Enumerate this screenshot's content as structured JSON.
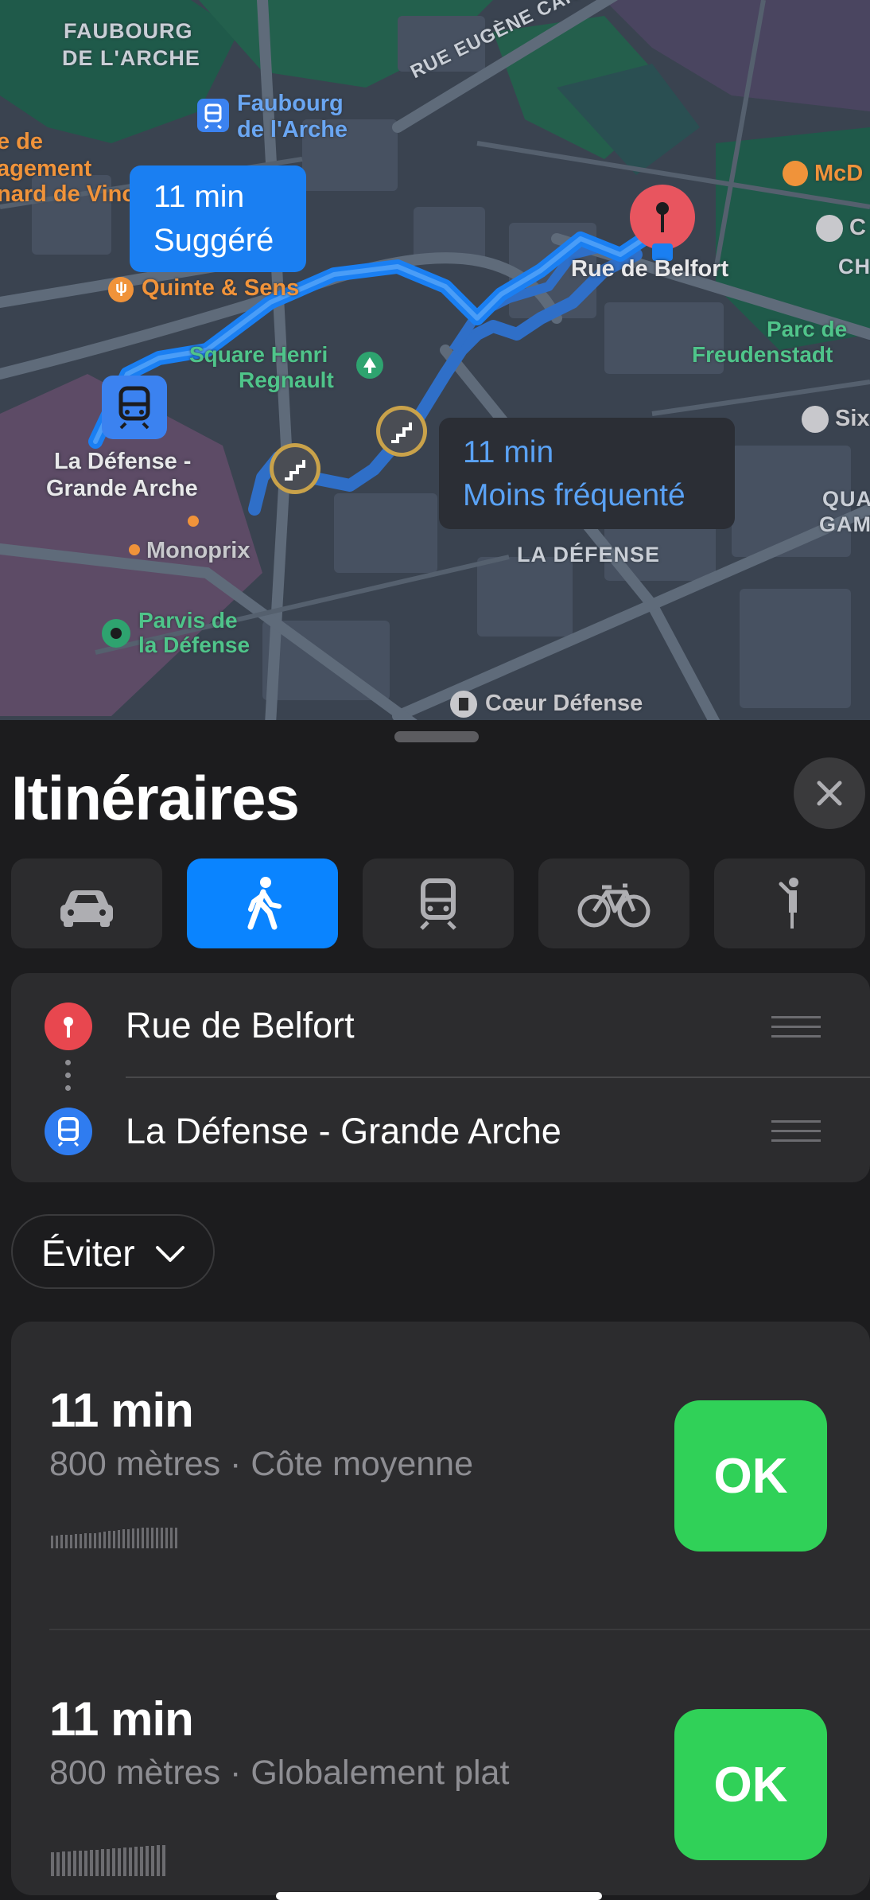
{
  "map": {
    "streets": [
      "FAUBOURG",
      "DE L'ARCHE",
      "RUE EUGÈNE CARON",
      "LA DÉFENSE"
    ],
    "edge_labels": [
      "e de",
      "agement",
      "nard de Vinci"
    ],
    "metro_station": [
      "Faubourg",
      "de l'Arche"
    ],
    "restaurant": "Quinte & Sens",
    "park_square": [
      "Square Henri",
      "Regnault"
    ],
    "destination_label": "Rue de Belfort",
    "start_station": [
      "La Défense -",
      "Grande Arche"
    ],
    "monoprix": "Monoprix",
    "parvis": [
      "Parvis de",
      "la Défense"
    ],
    "coeur": "Cœur Défense",
    "parc": [
      "Parc de",
      "Freudenstadt"
    ],
    "right_edge": {
      "mcd": "McD",
      "c": "C",
      "ch": "CH",
      "six": "Six",
      "quartier": [
        "QUA",
        "GAM"
      ]
    },
    "callout_suggested": {
      "time": "11 min",
      "label": "Suggéré"
    },
    "callout_alt": {
      "time": "11 min",
      "label": "Moins fréquenté"
    },
    "colors": {
      "route": "#1a7ff2",
      "alt_route": "#2f6fc8",
      "dest_pin": "#e8555f"
    }
  },
  "sheet": {
    "title": "Itinéraires",
    "modes": [
      {
        "icon": "car-icon",
        "active": false
      },
      {
        "icon": "walk-icon",
        "active": true
      },
      {
        "icon": "transit-icon",
        "active": false
      },
      {
        "icon": "bike-icon",
        "active": false
      },
      {
        "icon": "rideshare-icon",
        "active": false
      }
    ],
    "from": "Rue de Belfort",
    "to": "La Défense - Grande Arche",
    "avoid_label": "Éviter",
    "routes": [
      {
        "time": "11 min",
        "detail": "800 mètres · Côte moyenne",
        "go": "OK"
      },
      {
        "time": "11 min",
        "detail": "800 mètres · Globalement plat",
        "go": "OK"
      }
    ],
    "accent": "#0a84ff",
    "go_color": "#30d158"
  }
}
